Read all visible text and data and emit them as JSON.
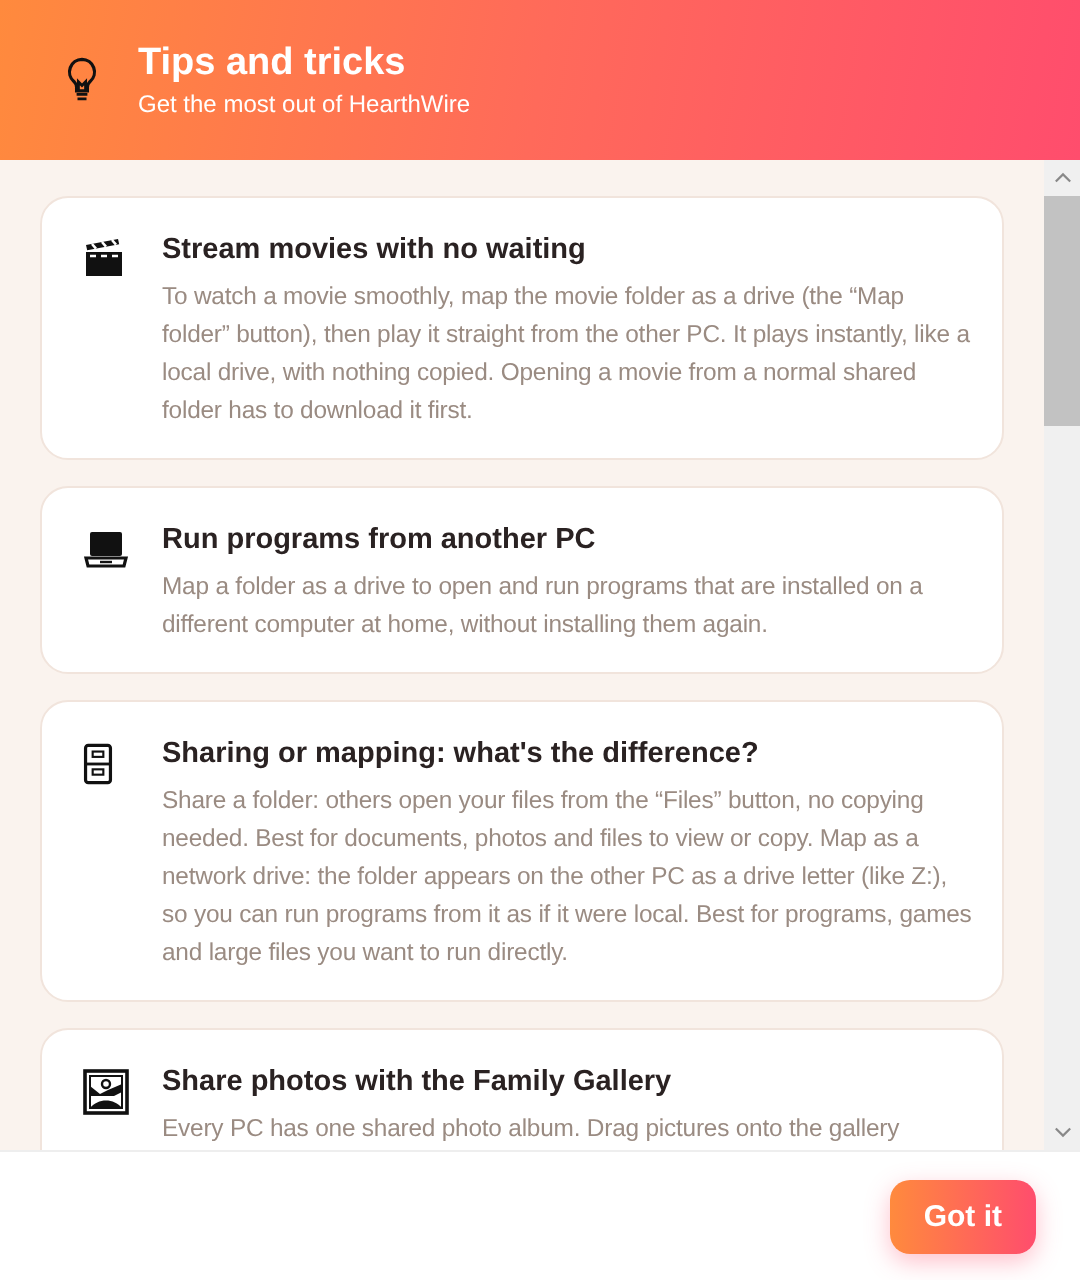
{
  "header": {
    "title": "Tips and tricks",
    "subtitle": "Get the most out of HearthWire"
  },
  "tips": [
    {
      "title": "Stream movies with no waiting",
      "body": "To watch a movie smoothly, map the movie folder as a drive (the “Map folder” button), then play it straight from the other PC. It plays instantly, like a local drive, with nothing copied. Opening a movie from a normal shared folder has to download it first."
    },
    {
      "title": "Run programs from another PC",
      "body": "Map a folder as a drive to open and run programs that are installed on a different computer at home, without installing them again."
    },
    {
      "title": "Sharing or mapping: what's the difference?",
      "body": "Share a folder: others open your files from the “Files” button, no copying needed. Best for documents, photos and files to view or copy. Map as a network drive: the folder appears on the other PC as a drive letter (like Z:), so you can run programs from it as if it were local. Best for programs, games and large files you want to run directly."
    },
    {
      "title": "Share photos with the Family Gallery",
      "body": "Every PC has one shared photo album. Drag pictures onto the gallery"
    }
  ],
  "footer": {
    "button": "Got it"
  }
}
